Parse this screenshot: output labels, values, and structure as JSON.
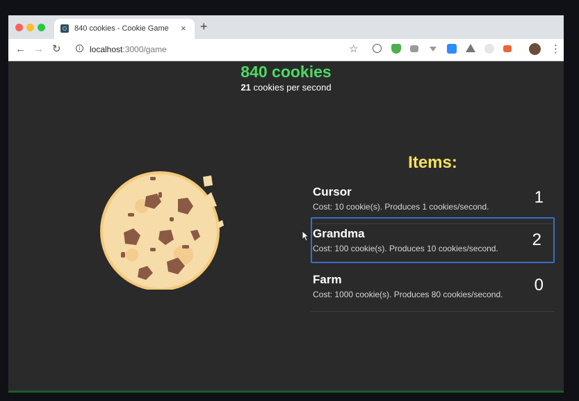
{
  "browser": {
    "tab_title": "840 cookies - Cookie Game",
    "tab_close": "×",
    "new_tab": "+",
    "url_host": "localhost",
    "url_path": ":3000/game",
    "icons": [
      "back-icon",
      "forward-icon",
      "reload-icon",
      "info-icon",
      "star-icon",
      "extension-icons",
      "avatar",
      "menu-icon"
    ]
  },
  "game": {
    "cookie_count": "840 cookies",
    "cps_value": "21",
    "cps_label": " cookies per second",
    "items_title": "Items:",
    "items": [
      {
        "name": "Cursor",
        "desc": "Cost: 10 cookie(s). Produces 1 cookies/second.",
        "count": "1"
      },
      {
        "name": "Grandma",
        "desc": "Cost: 100 cookie(s). Produces 10 cookies/second.",
        "count": "2"
      },
      {
        "name": "Farm",
        "desc": "Cost: 1000 cookie(s). Produces 80 cookies/second.",
        "count": "0"
      }
    ]
  },
  "colors": {
    "cookie_count": "#4cd964",
    "items_title": "#f6e05e",
    "background": "#2a2a2a",
    "selected_border": "#3a6ec8"
  }
}
